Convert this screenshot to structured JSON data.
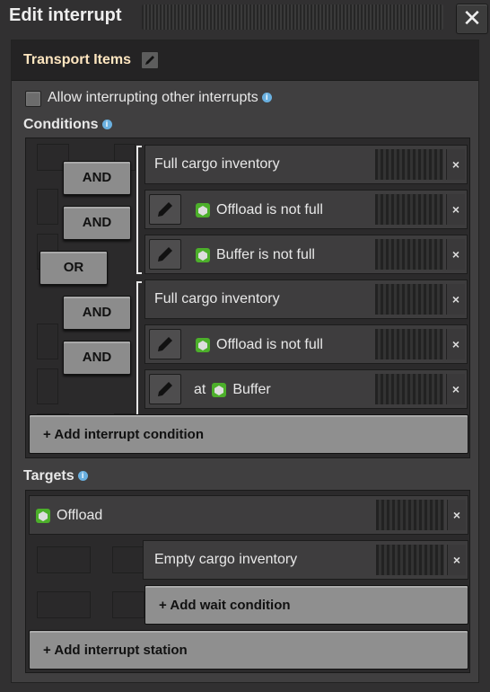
{
  "window": {
    "title": "Edit interrupt",
    "close_label": "✕"
  },
  "interrupt": {
    "name": "Transport Items"
  },
  "allow_label": "Allow interrupting other interrupts",
  "allow_checked": false,
  "conditions": {
    "heading": "Conditions",
    "operators": [
      "AND",
      "AND",
      "OR",
      "AND",
      "AND"
    ],
    "rows": [
      {
        "text": "Full cargo inventory",
        "icon": null,
        "prefix": "",
        "editable": false
      },
      {
        "text": "Offload is not full",
        "icon": "green-circuit-station-icon",
        "prefix": "",
        "editable": true
      },
      {
        "text": "Buffer is not full",
        "icon": "green-circuit-station-icon",
        "prefix": "",
        "editable": true
      },
      {
        "text": "Full cargo inventory",
        "icon": null,
        "prefix": "",
        "editable": false
      },
      {
        "text": "Offload is not full",
        "icon": "green-circuit-station-icon",
        "prefix": "",
        "editable": true
      },
      {
        "text": "Buffer",
        "icon": "green-circuit-station-icon",
        "prefix": "at",
        "editable": true
      }
    ],
    "add_label": "+ Add interrupt condition",
    "remove_label": "×"
  },
  "targets": {
    "heading": "Targets",
    "station": {
      "name": "Offload",
      "icon": "green-circuit-station-icon"
    },
    "wait_condition": "Empty cargo inventory",
    "add_wait_label": "+ Add wait condition",
    "add_station_label": "+ Add interrupt station"
  },
  "info_icon": "i",
  "colors": {
    "accent_title": "#ffe6c0",
    "button": "#8f8f8f",
    "panel": "#2b2a2b"
  }
}
